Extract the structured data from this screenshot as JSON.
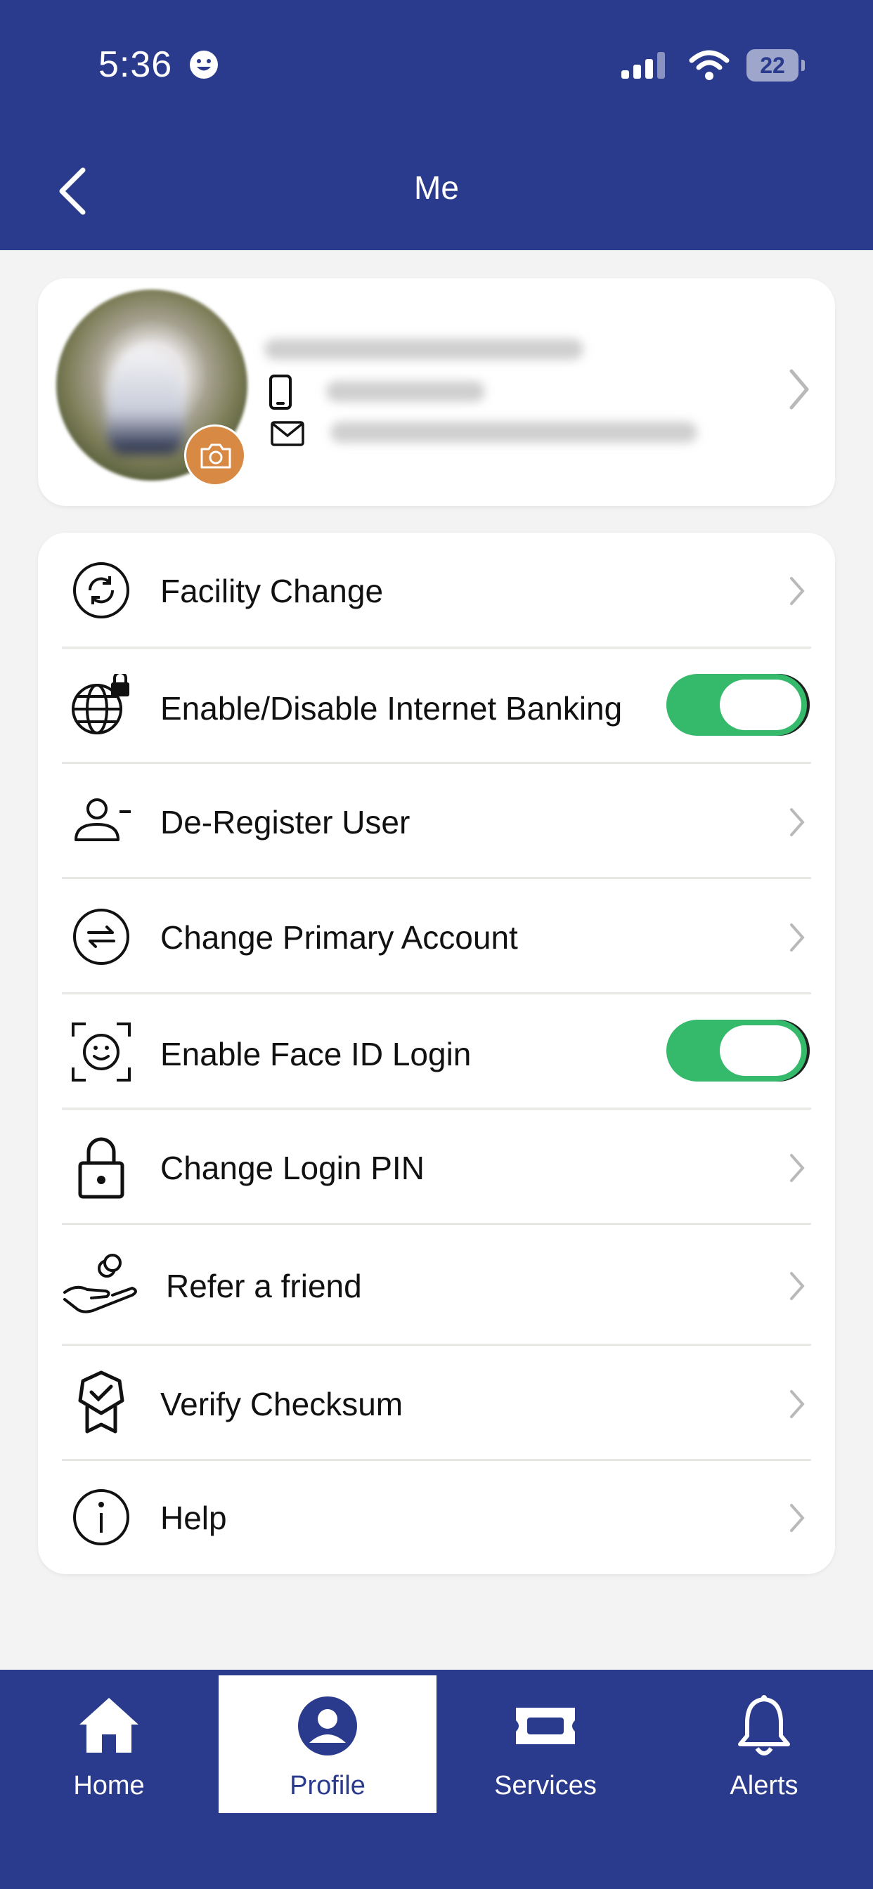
{
  "status_bar": {
    "time": "5:36",
    "battery": "22"
  },
  "header": {
    "title": "Me"
  },
  "menu": {
    "items": [
      {
        "label": "Facility Change",
        "icon": "sync-icon",
        "control": "chevron"
      },
      {
        "label": "Enable/Disable Internet Banking",
        "icon": "globe-lock-icon",
        "control": "toggle",
        "enabled": true
      },
      {
        "label": "De-Register User",
        "icon": "user-remove-icon",
        "control": "chevron"
      },
      {
        "label": "Change Primary Account",
        "icon": "swap-arrows-icon",
        "control": "chevron"
      },
      {
        "label": "Enable Face ID Login",
        "icon": "face-id-icon",
        "control": "toggle",
        "enabled": true
      },
      {
        "label": "Change Login PIN",
        "icon": "lock-icon",
        "control": "chevron"
      },
      {
        "label": "Refer a friend",
        "icon": "hand-coins-icon",
        "control": "chevron"
      },
      {
        "label": "Verify Checksum",
        "icon": "badge-check-icon",
        "control": "chevron"
      },
      {
        "label": "Help",
        "icon": "info-icon",
        "control": "chevron"
      }
    ]
  },
  "tabbar": {
    "tabs": [
      {
        "label": "Home",
        "icon": "home-icon",
        "active": false
      },
      {
        "label": "Profile",
        "icon": "profile-icon",
        "active": true
      },
      {
        "label": "Services",
        "icon": "ticket-icon",
        "active": false
      },
      {
        "label": "Alerts",
        "icon": "bell-icon",
        "active": false
      }
    ]
  },
  "colors": {
    "brand": "#2a3a8c",
    "toggle_on": "#35b96b",
    "camera_badge": "#d88a45"
  }
}
